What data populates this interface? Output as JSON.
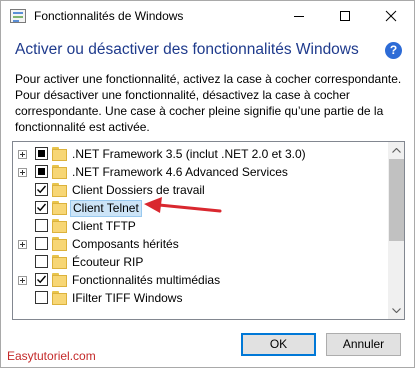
{
  "window": {
    "title": "Fonctionnalités de Windows"
  },
  "header": {
    "heading": "Activer ou désactiver des fonctionnalités Windows",
    "help": "?"
  },
  "description": "Pour activer une fonctionnalité, activez la case à cocher correspondante. Pour désactiver une fonctionnalité, désactivez la case à cocher correspondante. Une case à cocher pleine signifie qu’une partie de la fonctionnalité est activée.",
  "features": [
    {
      "label": ".NET Framework 3.5 (inclut .NET 2.0 et 3.0)",
      "expandable": true,
      "state": "partial",
      "selected": false
    },
    {
      "label": ".NET Framework 4.6 Advanced Services",
      "expandable": true,
      "state": "partial",
      "selected": false
    },
    {
      "label": "Client Dossiers de travail",
      "expandable": false,
      "state": "checked",
      "selected": false
    },
    {
      "label": "Client Telnet",
      "expandable": false,
      "state": "checked",
      "selected": true
    },
    {
      "label": "Client TFTP",
      "expandable": false,
      "state": "unchecked",
      "selected": false
    },
    {
      "label": "Composants hérités",
      "expandable": true,
      "state": "unchecked",
      "selected": false
    },
    {
      "label": "Écouteur RIP",
      "expandable": false,
      "state": "unchecked",
      "selected": false
    },
    {
      "label": "Fonctionnalités multimédias",
      "expandable": true,
      "state": "checked",
      "selected": false
    },
    {
      "label": "IFilter TIFF Windows",
      "expandable": false,
      "state": "unchecked",
      "selected": false
    }
  ],
  "buttons": {
    "ok": "OK",
    "cancel": "Annuler"
  },
  "watermark": "Easytutoriel.com",
  "colors": {
    "heading": "#1e3a8c",
    "annotation_arrow": "#d9282f",
    "selection": "#cce4f7",
    "watermark": "#c42a2a"
  }
}
